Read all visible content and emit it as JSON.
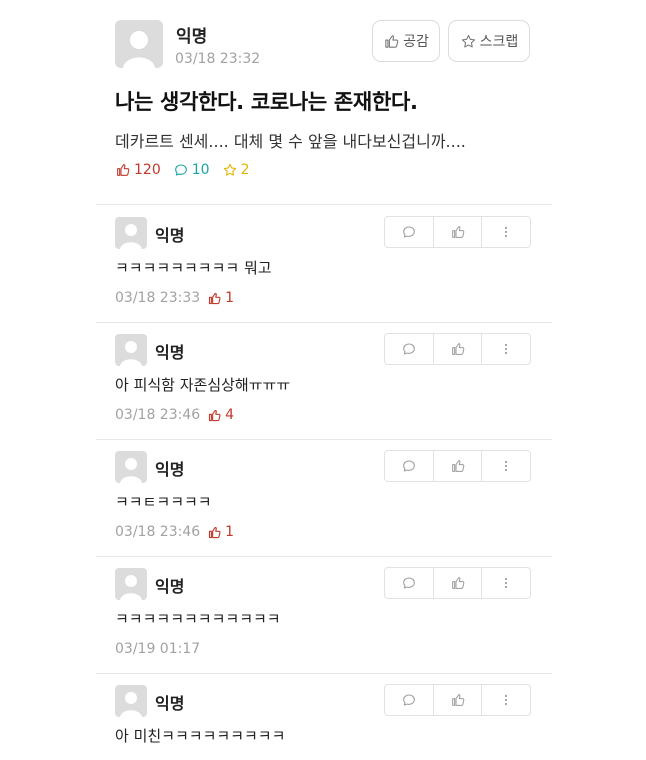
{
  "post": {
    "author": "익명",
    "time": "03/18 23:32",
    "like_button_label": "공감",
    "scrap_button_label": "스크랩",
    "title": "나는 생각한다. 코로나는 존재한다.",
    "body": "데카르트 센세.... 대체 몇 수 앞을 내다보신겁니까....",
    "like_count": "120",
    "comment_count": "10",
    "scrap_count": "2"
  },
  "comments": [
    {
      "author": "익명",
      "text": "ㅋㅋㅋㅋㅋㅋㅋㅋㅋ 뭐고",
      "time": "03/18 23:33",
      "likes": "1"
    },
    {
      "author": "익명",
      "text": "아 피식함 자존심상해ㅠㅠㅠ",
      "time": "03/18 23:46",
      "likes": "4"
    },
    {
      "author": "익명",
      "text": "ㅋㅋㅌㅋㅋㅋㅋ",
      "time": "03/18 23:46",
      "likes": "1"
    },
    {
      "author": "익명",
      "text": "ㅋㅋㅋㅋㅋㅋㅋㅋㅋㅋㅋㅋ",
      "time": "03/19 01:17",
      "likes": ""
    },
    {
      "author": "익명",
      "text": "아 미친ㅋㅋㅋㅋㅋㅋㅋㅋㅋ",
      "time": "",
      "likes": ""
    }
  ],
  "icons": {
    "avatar": "avatar-placeholder-icon",
    "like": "thumbs-up-icon",
    "comment": "speech-bubble-icon",
    "scrap": "star-icon",
    "more": "more-vertical-icon"
  },
  "colors": {
    "like": "#c0392b",
    "comment": "#1aa5a5",
    "scrap": "#e2b400",
    "muted": "#a2a2a2"
  }
}
